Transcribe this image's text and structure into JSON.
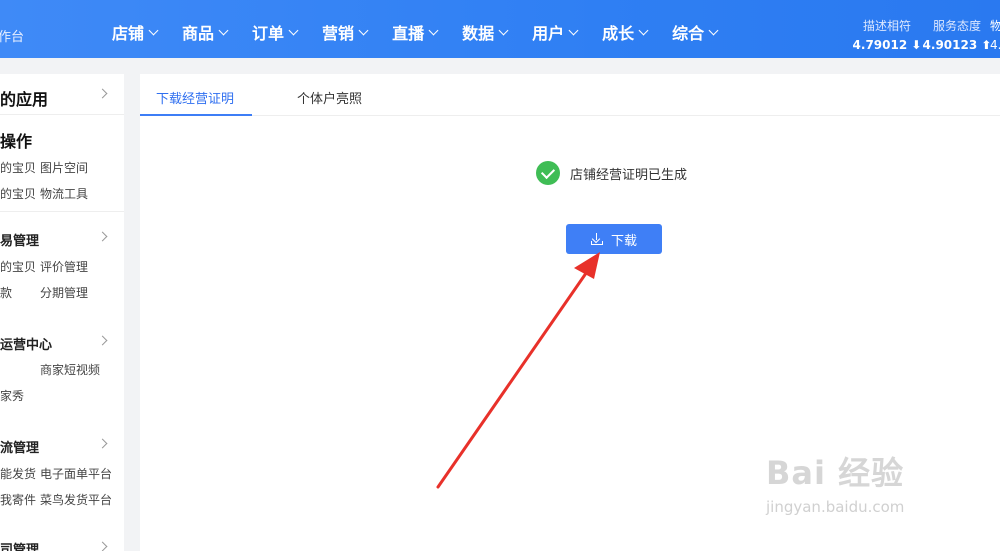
{
  "topbar": {
    "brand": "作台",
    "nav": [
      "店铺",
      "商品",
      "订单",
      "营销",
      "直播",
      "数据",
      "用户",
      "成长",
      "综合"
    ],
    "metrics": [
      {
        "label": "描述相符",
        "value": "4.79012 ⬇"
      },
      {
        "label": "服务态度",
        "value": "4.90123 ⬆"
      }
    ],
    "metric_extra_label": "物",
    "metric_extra_value": "4."
  },
  "sidebar": {
    "my_apps": "的应用",
    "ops_title": "操作",
    "ops_links": [
      "的宝贝",
      "图片空间",
      "的宝贝",
      "物流工具"
    ],
    "sections": [
      {
        "title": "易管理",
        "links": [
          "的宝贝",
          "评价管理",
          "款",
          "分期管理"
        ]
      },
      {
        "title": "运营中心",
        "links": [
          "商家短视频",
          "家秀"
        ]
      },
      {
        "title": "流管理",
        "links": [
          "能发货",
          "电子面单平台",
          "我寄件",
          "菜鸟发货平台"
        ]
      },
      {
        "title": "司管理"
      }
    ]
  },
  "main": {
    "tabs": [
      "下载经营证明",
      "个体户亮照"
    ],
    "status_text": "店铺经营证明已生成",
    "download_label": "下载"
  },
  "watermark": {
    "main": "Bai 经验",
    "sub": "jingyan.baidu.com"
  },
  "colors": {
    "accent": "#3f7ff6",
    "success": "#3fbd55",
    "arrow": "#e8312a"
  }
}
